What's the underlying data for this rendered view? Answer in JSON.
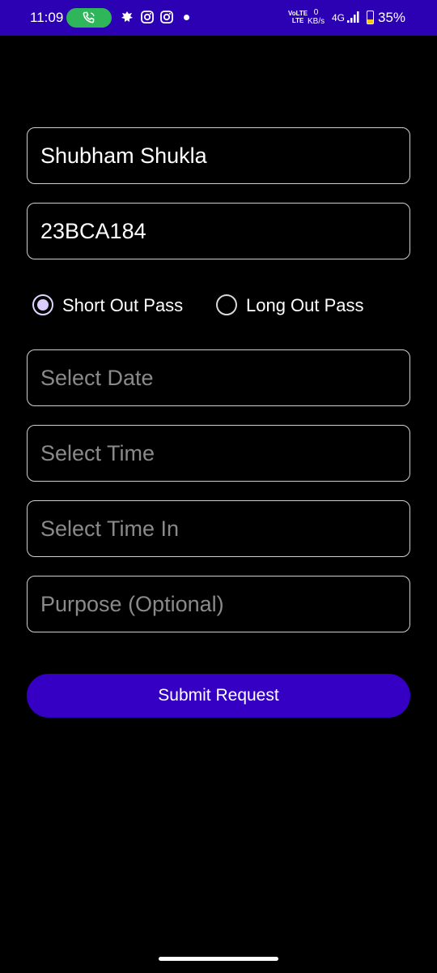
{
  "status_bar": {
    "time": "11:09",
    "call_icon": "phone-icon",
    "notification_icons": [
      "app-notification-icon",
      "instagram-icon",
      "instagram-icon"
    ],
    "network_volte": "VoLTE",
    "network_lte": "LTE",
    "data_rate_value": "0",
    "data_rate_unit": "KB/s",
    "network_type": "4G",
    "battery_percent": "35%",
    "battery_level": 0.35,
    "bar_color": "#2c00b3"
  },
  "form": {
    "name_value": "Shubham Shukla",
    "roll_value": "23BCA184",
    "pass_types": [
      {
        "label": "Short Out Pass",
        "selected": true
      },
      {
        "label": "Long Out Pass",
        "selected": false
      }
    ],
    "date_placeholder": "Select Date",
    "time_placeholder": "Select Time",
    "time_in_placeholder": "Select Time In",
    "purpose_placeholder": "Purpose (Optional)",
    "submit_label": "Submit Request",
    "accent_color": "#3500c4"
  }
}
